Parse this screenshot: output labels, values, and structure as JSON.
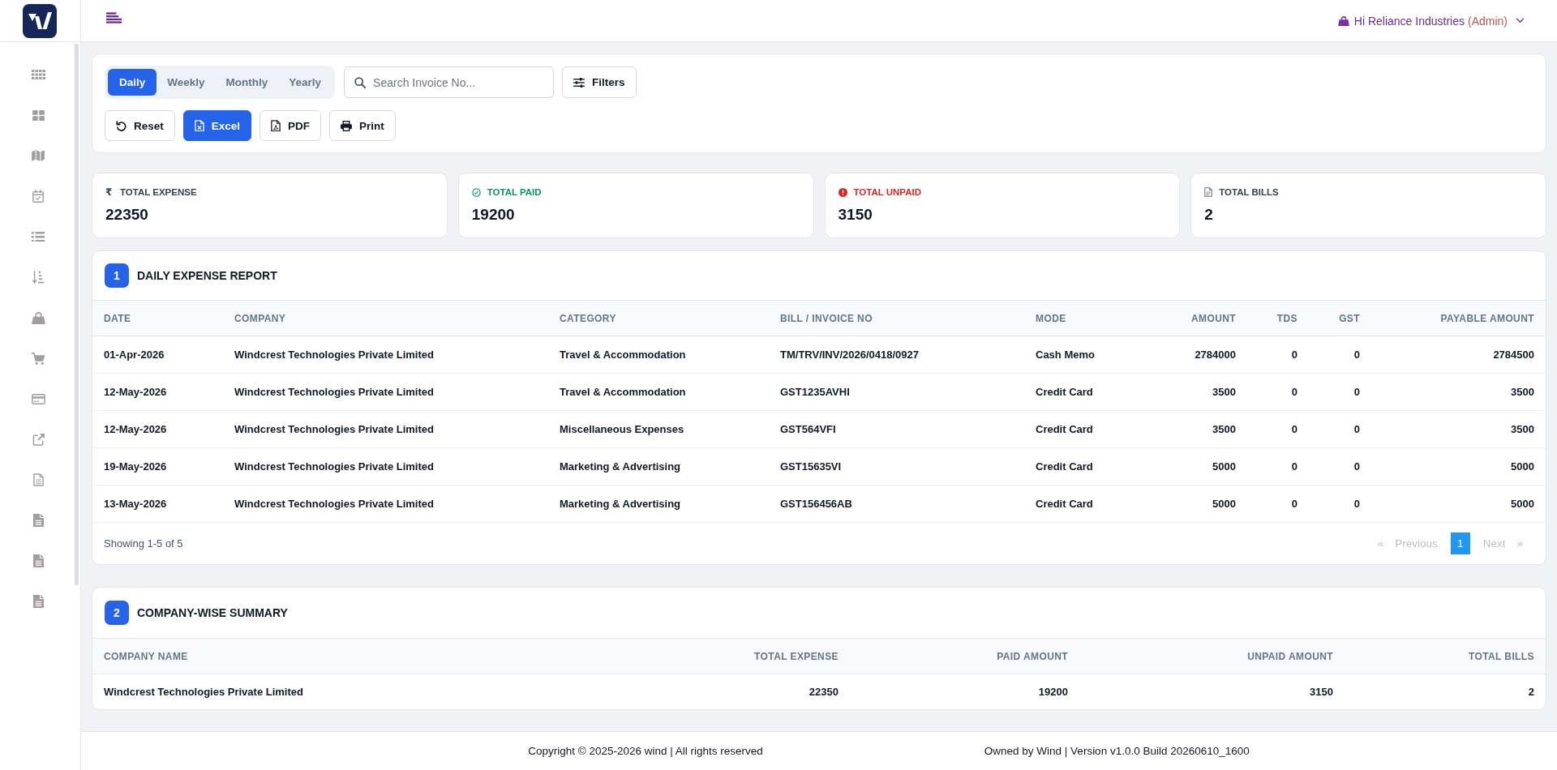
{
  "header": {
    "user": {
      "greeting": "Hi Reliance Industries",
      "role": "(Admin)"
    }
  },
  "toolbar": {
    "periods": [
      {
        "label": "Daily",
        "selected": true
      },
      {
        "label": "Weekly",
        "selected": false
      },
      {
        "label": "Monthly",
        "selected": false
      },
      {
        "label": "Yearly",
        "selected": false
      }
    ],
    "search": {
      "placeholder": "Search Invoice No..."
    },
    "filter_button": {
      "label": "Filters"
    },
    "actions": [
      {
        "kind": "reset",
        "label": "Reset",
        "primary": false
      },
      {
        "kind": "excel",
        "label": "Excel",
        "primary": true
      },
      {
        "kind": "pdf",
        "label": "PDF",
        "primary": false
      },
      {
        "kind": "print",
        "label": "Print",
        "primary": false
      }
    ]
  },
  "stats": [
    {
      "kind": "currency",
      "symbol": "₹",
      "label": "TOTAL EXPENSE",
      "value": "22350",
      "color": "#334155"
    },
    {
      "kind": "paid",
      "label": "TOTAL PAID",
      "value": "19200",
      "color": "#059669"
    },
    {
      "kind": "unpaid",
      "label": "TOTAL UNPAID",
      "value": "3150",
      "color": "#dc2626"
    },
    {
      "kind": "bills",
      "label": "TOTAL BILLS",
      "value": "2",
      "color": "#334155"
    }
  ],
  "report": {
    "number": "1",
    "title": "DAILY EXPENSE REPORT",
    "columns": [
      {
        "label": "DATE",
        "kind": "text"
      },
      {
        "label": "COMPANY",
        "kind": "text"
      },
      {
        "label": "CATEGORY",
        "kind": "text"
      },
      {
        "label": "BILL / INVOICE NO",
        "kind": "text"
      },
      {
        "label": "MODE",
        "kind": "text"
      },
      {
        "label": "AMOUNT",
        "kind": "number"
      },
      {
        "label": "TDS",
        "kind": "number"
      },
      {
        "label": "GST",
        "kind": "number"
      },
      {
        "label": "PAYABLE AMOUNT",
        "kind": "number"
      }
    ],
    "rows": [
      [
        "01-Apr-2026",
        "Windcrest Technologies Private Limited",
        "Travel & Accommodation",
        "TM/TRV/INV/2026/0418/0927",
        "Cash Memo",
        "2784000",
        "0",
        "0",
        "2784500"
      ],
      [
        "12-May-2026",
        "Windcrest Technologies Private Limited",
        "Travel & Accommodation",
        "GST1235AVHI",
        "Credit Card",
        "3500",
        "0",
        "0",
        "3500"
      ],
      [
        "12-May-2026",
        "Windcrest Technologies Private Limited",
        "Miscellaneous Expenses",
        "GST564VFI",
        "Credit Card",
        "3500",
        "0",
        "0",
        "3500"
      ],
      [
        "19-May-2026",
        "Windcrest Technologies Private Limited",
        "Marketing & Advertising",
        "GST15635VI",
        "Credit Card",
        "5000",
        "0",
        "0",
        "5000"
      ],
      [
        "13-May-2026",
        "Windcrest Technologies Private Limited",
        "Marketing & Advertising",
        "GST156456AB",
        "Credit Card",
        "5000",
        "0",
        "0",
        "5000"
      ]
    ],
    "summary": "Showing 1-5 of 5",
    "pagination": {
      "first": {
        "label": "«",
        "disabled": true
      },
      "previous": {
        "label": "Previous",
        "disabled": true
      },
      "pages": [
        {
          "label": "1",
          "selected": true
        }
      ],
      "next": {
        "label": "Next",
        "disabled": true
      },
      "last": {
        "label": "»",
        "disabled": true
      }
    }
  },
  "company_summary": {
    "number": "2",
    "title": "COMPANY-WISE SUMMARY",
    "columns": [
      {
        "label": "COMPANY NAME",
        "kind": "text"
      },
      {
        "label": "TOTAL EXPENSE",
        "kind": "number"
      },
      {
        "label": "PAID AMOUNT",
        "kind": "number"
      },
      {
        "label": "UNPAID AMOUNT",
        "kind": "number"
      },
      {
        "label": "TOTAL BILLS",
        "kind": "number"
      }
    ],
    "rows": [
      [
        "Windcrest Technologies Private Limited",
        "22350",
        "19200",
        "3150",
        "2"
      ]
    ]
  },
  "footer": {
    "copyright": "Copyright © 2025-2026 wind | All rights reserved",
    "version": "Owned by Wind | Version v1.0.0 Build 20260610_1600"
  }
}
